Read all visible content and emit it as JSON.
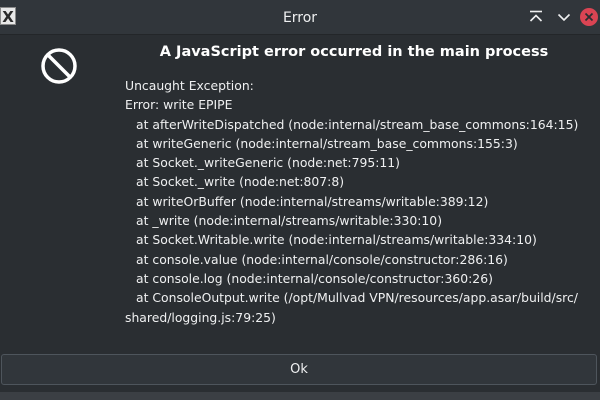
{
  "window": {
    "title": "Error",
    "app_icon_glyph": "X",
    "buttons": {
      "keep_above_icon": "keep-above-icon",
      "minimize_icon": "minimize-icon",
      "close_icon": "close-icon"
    },
    "colors": {
      "background": "#2a2e32",
      "titlebar": "#31363b",
      "close_button": "#da4453",
      "text": "#eff0f1"
    }
  },
  "dialog": {
    "icon": "stop-icon",
    "heading": "A JavaScript error occurred in the main process",
    "message": {
      "exception": "Uncaught Exception:",
      "error": "Error: write EPIPE",
      "stack": [
        "at afterWriteDispatched (node:internal/stream_base_commons:164:15)",
        "at writeGeneric (node:internal/stream_base_commons:155:3)",
        "at Socket._writeGeneric (node:net:795:11)",
        "at Socket._write (node:net:807:8)",
        "at writeOrBuffer (node:internal/streams/writable:389:12)",
        "at _write (node:internal/streams/writable:330:10)",
        "at Socket.Writable.write (node:internal/streams/writable:334:10)",
        "at console.value (node:internal/console/constructor:286:16)",
        "at console.log (node:internal/console/constructor:360:26)",
        "at ConsoleOutput.write (/opt/Mullvad VPN/resources/app.asar/build/src/"
      ],
      "stack_tail": "shared/logging.js:79:25)"
    },
    "ok_label": "Ok"
  }
}
